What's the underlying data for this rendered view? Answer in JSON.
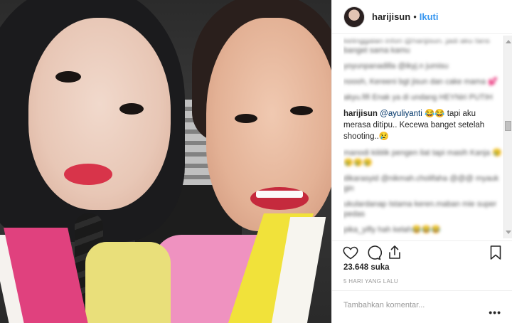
{
  "post": {
    "username": "harijisun",
    "separator": "•",
    "follow_label": "Ikuti"
  },
  "comments": [
    {
      "text": "kelinggalan infori @harijisun. jadi aku fans banget sama kamu",
      "blurred": true
    },
    {
      "text": "yoyunpanadilla @ikyj.n jumisu",
      "blurred": true
    },
    {
      "text": "noooh, Kereeni bgt jisun dan cake mama 💕",
      "blurred": true
    },
    {
      "text": "akyu.fifi Enak ya di undang HEYNiri PUTIH",
      "blurred": true
    },
    {
      "user": "harijisun",
      "mention": "@ayuliyanti",
      "text": " 😂😂 tapi aku merasa ditipu.. Kecewa banget setelah shooting..😢",
      "blurred": false
    },
    {
      "text": "manodi kiiiiiik pengen liat tapi masih Kanja 😢😢😢😢",
      "blurred": true
    },
    {
      "text": "dikarasyid @nikmah.cholifaha @@@ myauk gin",
      "blurred": true
    },
    {
      "text": "ukulardanap Istama keren.maban mie super pedas",
      "blurred": true
    },
    {
      "text": "pika_yifly hah kelah😂😂😂",
      "blurred": true
    }
  ],
  "likes": "23.648 suka",
  "time": "5 HARI YANG LALU",
  "add_comment": {
    "placeholder": "Tambahkan komentar..."
  },
  "more_label": "•••",
  "icons": {
    "like": "heart-icon",
    "comment": "comment-bubble-icon",
    "share": "share-icon",
    "save": "bookmark-icon"
  },
  "colors": {
    "link": "#3897f0",
    "text": "#262626",
    "muted": "#999999"
  }
}
